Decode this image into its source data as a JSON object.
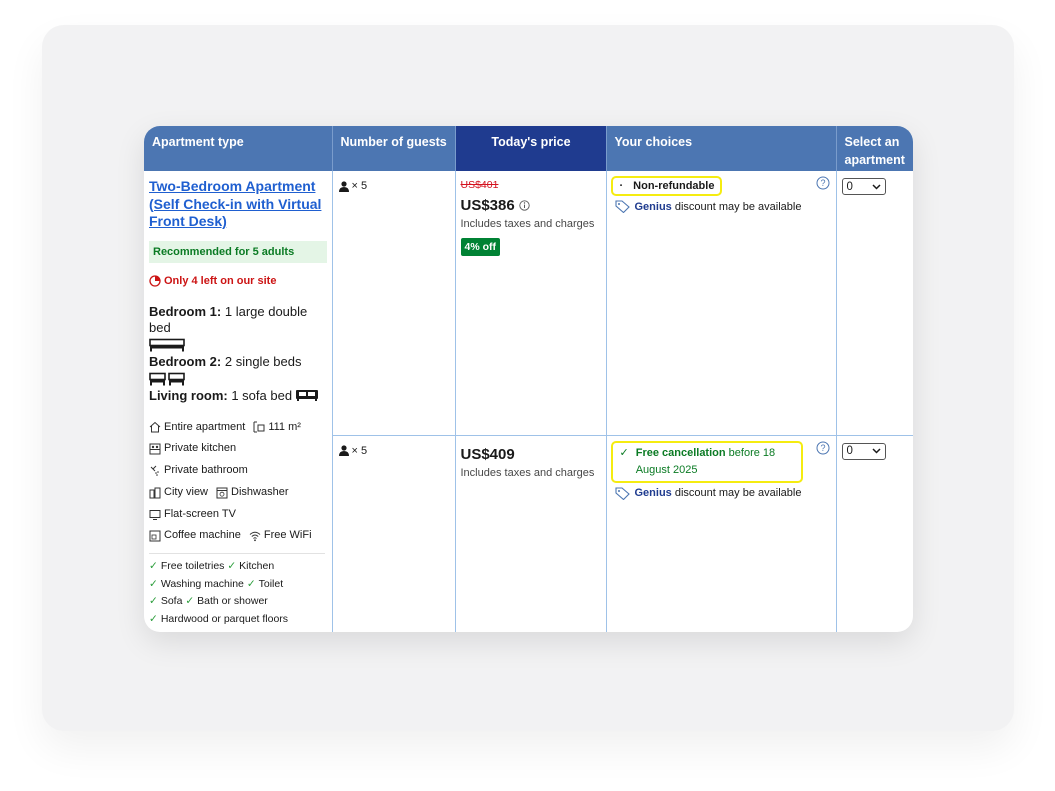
{
  "headers": {
    "apartment_type": "Apartment type",
    "guests": "Number of guests",
    "price": "Today's price",
    "choices": "Your choices",
    "select_line1": "Select an",
    "select_line2": "apartment"
  },
  "room": {
    "name": "Two-Bedroom Apartment (Self Check-in with Virtual Front Desk)",
    "recommended": "Recommended for 5 adults",
    "availability": "Only 4 left on our site",
    "bedroom1_label": "Bedroom 1:",
    "bedroom1_beds": "1 large double bed",
    "bedroom2_label": "Bedroom 2:",
    "bedroom2_beds": "2 single beds",
    "living_label": "Living room:",
    "living_beds": "1 sofa bed",
    "facilities": {
      "entire": "Entire apartment",
      "size": "111 m²",
      "kitchen": "Private kitchen",
      "bathroom": "Private bathroom",
      "view": "City view",
      "dishwasher": "Dishwasher",
      "tv": "Flat-screen TV",
      "coffee": "Coffee machine",
      "wifi": "Free WiFi"
    },
    "amenities": {
      "toiletries": "Free toiletries",
      "kitchen": "Kitchen",
      "washing": "Washing machine",
      "toilet": "Toilet",
      "sofa": "Sofa",
      "bath": "Bath or shower",
      "floors": "Hardwood or parquet floors"
    }
  },
  "options": [
    {
      "guests": "× 5",
      "old_price": "US$401",
      "price": "US$386",
      "taxes": "Includes taxes and charges",
      "discount": "4% off",
      "policy": "Non-refundable",
      "genius": "Genius",
      "genius_text": "discount may be available",
      "select_value": "0"
    },
    {
      "guests": "× 5",
      "price": "US$409",
      "taxes": "Includes taxes and charges",
      "policy_bold": "Free cancellation",
      "policy_rest": "before 18 August 2025",
      "genius": "Genius",
      "genius_text": "discount may be available",
      "select_value": "0"
    }
  ],
  "colors": {
    "header": "#4c76b2",
    "header_today": "#1f3b8f",
    "link": "#1f5fd0",
    "highlight": "#f5ec10",
    "green": "#0b7b24",
    "red": "#d4111e"
  }
}
